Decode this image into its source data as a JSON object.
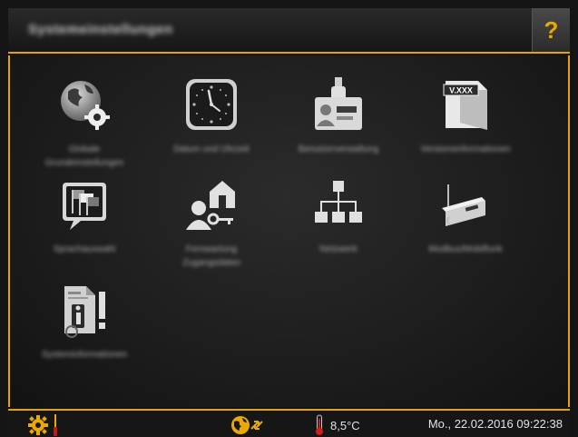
{
  "header": {
    "title": "Systemeinstellungen",
    "help_label": "?"
  },
  "tiles": [
    {
      "label": "Globale Grundeinstellungen"
    },
    {
      "label": "Datum und Uhrzeit"
    },
    {
      "label": "Benutzerverwaltung"
    },
    {
      "label": "Versionsinformationen"
    },
    {
      "label": "Sprachauswahl"
    },
    {
      "label": "Fernwartung Zugangsdaten"
    },
    {
      "label": "Netzwerk"
    },
    {
      "label": "Modbus/Mobilfunk"
    },
    {
      "label": "Systeminformationen"
    }
  ],
  "status_bar": {
    "temperature": "8,5°C",
    "datetime": "Mo., 22.02.2016 09:22:38"
  },
  "colors": {
    "accent": "#e3a500",
    "background": "#141414"
  }
}
